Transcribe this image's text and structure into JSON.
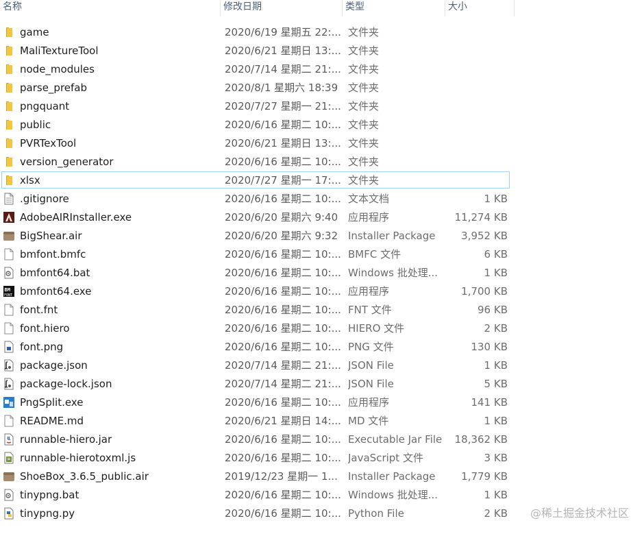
{
  "header": {
    "name": "名称",
    "date": "修改日期",
    "type": "类型",
    "size": "大小"
  },
  "rows": [
    {
      "name": "game",
      "date": "2020/6/19 星期五 22:...",
      "type": "文件夹",
      "size": "",
      "icon": "folder-icon"
    },
    {
      "name": "MaliTextureTool",
      "date": "2020/6/21 星期日 13:...",
      "type": "文件夹",
      "size": "",
      "icon": "folder-icon"
    },
    {
      "name": "node_modules",
      "date": "2020/7/14 星期二 21:...",
      "type": "文件夹",
      "size": "",
      "icon": "folder-icon"
    },
    {
      "name": "parse_prefab",
      "date": "2020/8/1 星期六 18:39",
      "type": "文件夹",
      "size": "",
      "icon": "folder-icon"
    },
    {
      "name": "pngquant",
      "date": "2020/7/27 星期一 21:...",
      "type": "文件夹",
      "size": "",
      "icon": "folder-icon"
    },
    {
      "name": "public",
      "date": "2020/6/16 星期二 10:...",
      "type": "文件夹",
      "size": "",
      "icon": "folder-icon"
    },
    {
      "name": "PVRTexTool",
      "date": "2020/6/21 星期日 13:...",
      "type": "文件夹",
      "size": "",
      "icon": "folder-icon"
    },
    {
      "name": "version_generator",
      "date": "2020/6/16 星期二 10:...",
      "type": "文件夹",
      "size": "",
      "icon": "folder-icon"
    },
    {
      "name": "xlsx",
      "date": "2020/7/27 星期一 17:...",
      "type": "文件夹",
      "size": "",
      "icon": "folder-icon",
      "selected": true
    },
    {
      "name": ".gitignore",
      "date": "2020/6/16 星期二 10:...",
      "type": "文本文档",
      "size": "1 KB",
      "icon": "text-file-icon"
    },
    {
      "name": "AdobeAIRInstaller.exe",
      "date": "2020/6/20 星期六 9:40",
      "type": "应用程序",
      "size": "11,274 KB",
      "icon": "adobe-air-icon"
    },
    {
      "name": "BigShear.air",
      "date": "2020/6/20 星期六 9:32",
      "type": "Installer Package",
      "size": "3,952 KB",
      "icon": "air-package-icon"
    },
    {
      "name": "bmfont.bmfc",
      "date": "2020/6/16 星期二 10:...",
      "type": "BMFC 文件",
      "size": "6 KB",
      "icon": "blank-file-icon"
    },
    {
      "name": "bmfont64.bat",
      "date": "2020/6/16 星期二 10:...",
      "type": "Windows 批处理...",
      "size": "1 KB",
      "icon": "batch-file-icon"
    },
    {
      "name": "bmfont64.exe",
      "date": "2020/6/16 星期二 10:...",
      "type": "应用程序",
      "size": "1,700 KB",
      "icon": "bmfont-app-icon"
    },
    {
      "name": "font.fnt",
      "date": "2020/6/16 星期二 10:...",
      "type": "FNT 文件",
      "size": "96 KB",
      "icon": "blank-file-icon"
    },
    {
      "name": "font.hiero",
      "date": "2020/6/16 星期二 10:...",
      "type": "HIERO 文件",
      "size": "2 KB",
      "icon": "blank-file-icon"
    },
    {
      "name": "font.png",
      "date": "2020/6/16 星期二 10:...",
      "type": "PNG 文件",
      "size": "130 KB",
      "icon": "image-file-icon"
    },
    {
      "name": "package.json",
      "date": "2020/7/14 星期二 21:...",
      "type": "JSON File",
      "size": "1 KB",
      "icon": "json-file-icon"
    },
    {
      "name": "package-lock.json",
      "date": "2020/7/14 星期二 21:...",
      "type": "JSON File",
      "size": "5 KB",
      "icon": "json-file-icon"
    },
    {
      "name": "PngSplit.exe",
      "date": "2020/6/16 星期二 10:...",
      "type": "应用程序",
      "size": "141 KB",
      "icon": "app-window-icon"
    },
    {
      "name": "README.md",
      "date": "2020/6/21 星期日 14:...",
      "type": "MD 文件",
      "size": "1 KB",
      "icon": "blank-file-icon"
    },
    {
      "name": "runnable-hiero.jar",
      "date": "2020/6/16 星期二 10:...",
      "type": "Executable Jar File",
      "size": "18,362 KB",
      "icon": "java-jar-icon"
    },
    {
      "name": "runnable-hierotoxml.js",
      "date": "2020/6/16 星期二 10:...",
      "type": "JavaScript 文件",
      "size": "3 KB",
      "icon": "javascript-file-icon"
    },
    {
      "name": "ShoeBox_3.6.5_public.air",
      "date": "2019/12/23 星期一 1...",
      "type": "Installer Package",
      "size": "1,779 KB",
      "icon": "air-package-icon"
    },
    {
      "name": "tinypng.bat",
      "date": "2020/6/16 星期二 10:...",
      "type": "Windows 批处理...",
      "size": "1 KB",
      "icon": "batch-file-icon"
    },
    {
      "name": "tinypng.py",
      "date": "2020/6/16 星期二 10:...",
      "type": "Python File",
      "size": "2 KB",
      "icon": "python-file-icon"
    }
  ],
  "watermark": "@稀土掘金技术社区",
  "colors": {
    "folder": "#f4c542",
    "folder_dark": "#dca722",
    "selection_border": "#99d1ff",
    "header_text": "#4c607a"
  }
}
